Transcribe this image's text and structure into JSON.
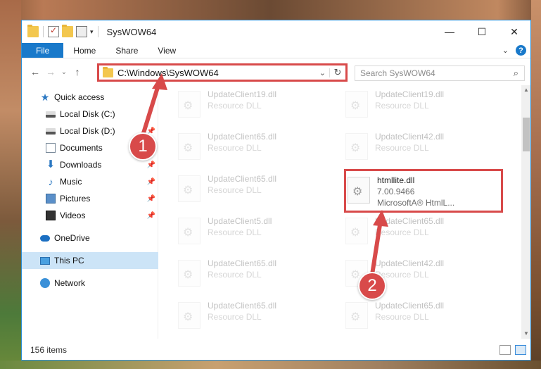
{
  "window": {
    "title": "SysWOW64",
    "controls": {
      "minimize": "—",
      "maximize": "☐",
      "close": "✕"
    }
  },
  "ribbon": {
    "tabs": [
      "File",
      "Home",
      "Share",
      "View"
    ],
    "help": "?"
  },
  "address": {
    "path": "C:\\Windows\\SysWOW64",
    "search_placeholder": "Search SysWOW64"
  },
  "nav_pane": {
    "items": [
      {
        "label": "Quick access",
        "icon": "star-icon",
        "pinned": false
      },
      {
        "label": "Local Disk (C:)",
        "icon": "drive-icon",
        "pinned": false
      },
      {
        "label": "Local Disk (D:)",
        "icon": "drive-icon",
        "pinned": true
      },
      {
        "label": "Documents",
        "icon": "document-icon",
        "pinned": false
      },
      {
        "label": "Downloads",
        "icon": "download-icon",
        "pinned": true
      },
      {
        "label": "Music",
        "icon": "music-icon",
        "pinned": true
      },
      {
        "label": "Pictures",
        "icon": "picture-icon",
        "pinned": true
      },
      {
        "label": "Videos",
        "icon": "video-icon",
        "pinned": true
      },
      {
        "label": "OneDrive",
        "icon": "cloud-icon",
        "pinned": false
      },
      {
        "label": "This PC",
        "icon": "computer-icon",
        "pinned": false,
        "selected": true
      },
      {
        "label": "Network",
        "icon": "network-icon",
        "pinned": false
      }
    ]
  },
  "files": [
    {
      "name": "UpdateClient19.dll",
      "sub": "Resource DLL"
    },
    {
      "name": "UpdateClient19.dll",
      "sub": "Resource DLL"
    },
    {
      "name": "UpdateClient65.dll",
      "sub": "Resource DLL"
    },
    {
      "name": "UpdateClient42.dll",
      "sub": "Resource DLL"
    },
    {
      "name": "UpdateClient65.dll",
      "sub": "Resource DLL"
    },
    {
      "name": "htmllite.dll",
      "sub": "7.00.9466",
      "sub2": "MicrosoftA® HtmlL...",
      "highlight": true
    },
    {
      "name": "UpdateClient5.dll",
      "sub": "Resource DLL"
    },
    {
      "name": "UpdateClient65.dll",
      "sub": "Resource DLL"
    },
    {
      "name": "UpdateClient65.dll",
      "sub": "Resource DLL"
    },
    {
      "name": "UpdateClient42.dll",
      "sub": "Resource DLL"
    },
    {
      "name": "UpdateClient65.dll",
      "sub": "Resource DLL"
    },
    {
      "name": "UpdateClient65.dll",
      "sub": "Resource DLL"
    }
  ],
  "status": {
    "item_count": "156 items"
  },
  "callouts": [
    "1",
    "2"
  ],
  "colors": {
    "accent": "#1979ca",
    "highlight": "#d84a4a",
    "selection": "#cce4f7"
  }
}
